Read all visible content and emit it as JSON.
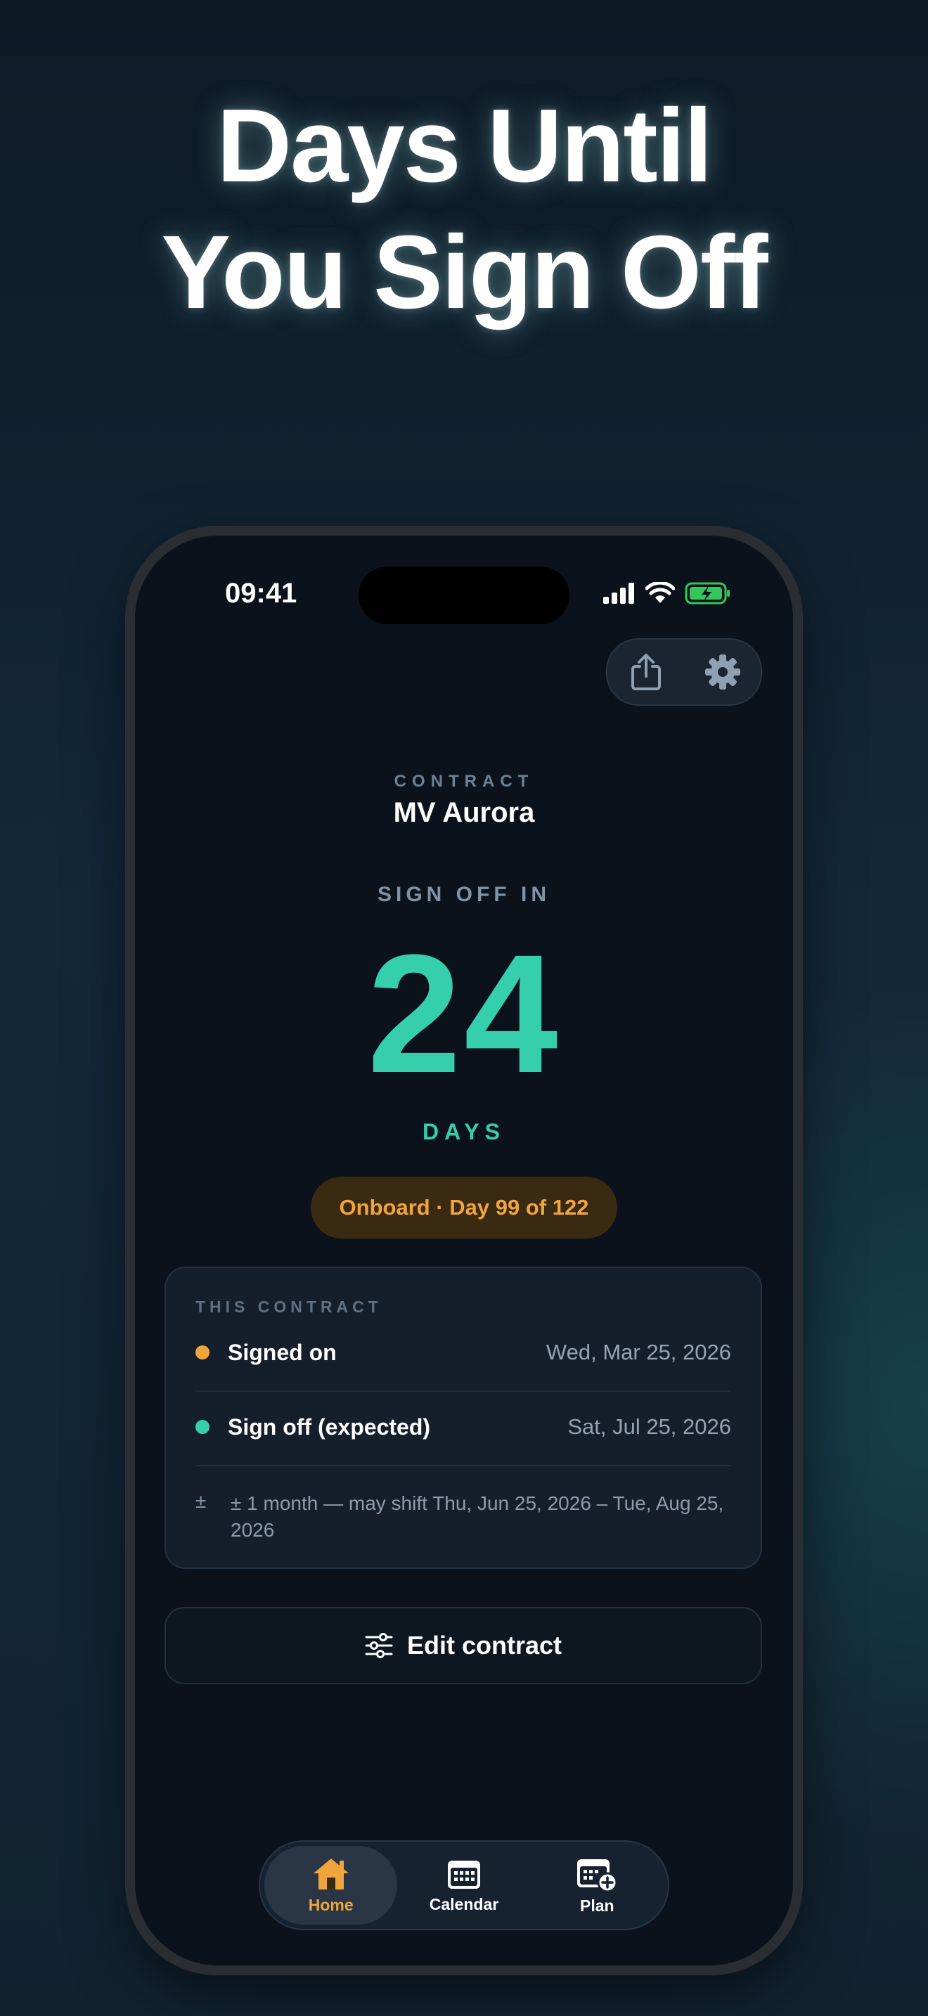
{
  "headline": {
    "line1": "Days Until",
    "line2": "You Sign Off"
  },
  "status_bar": {
    "time": "09:41"
  },
  "contract": {
    "label": "CONTRACT",
    "name": "MV Aurora"
  },
  "countdown": {
    "label": "SIGN OFF IN",
    "value": "24",
    "unit": "DAYS"
  },
  "status_pill": "Onboard · Day 99 of 122",
  "card": {
    "title": "THIS CONTRACT",
    "rows": [
      {
        "label": "Signed on",
        "value": "Wed, Mar 25, 2026",
        "dot_color": "#f0a53c"
      },
      {
        "label": "Sign off (expected)",
        "value": "Sat, Jul 25, 2026",
        "dot_color": "#35cfae"
      }
    ],
    "note_symbol": "±",
    "note": "± 1 month — may shift Thu, Jun 25, 2026 – Tue, Aug 25, 2026"
  },
  "edit_button": "Edit contract",
  "tabs": [
    {
      "label": "Home",
      "icon": "home-icon",
      "active": true
    },
    {
      "label": "Calendar",
      "icon": "calendar-icon",
      "active": false
    },
    {
      "label": "Plan",
      "icon": "calendar-plus-icon",
      "active": false
    }
  ],
  "colors": {
    "accent_teal": "#35cfae",
    "accent_orange": "#f0a53c",
    "battery_green": "#34c759"
  }
}
